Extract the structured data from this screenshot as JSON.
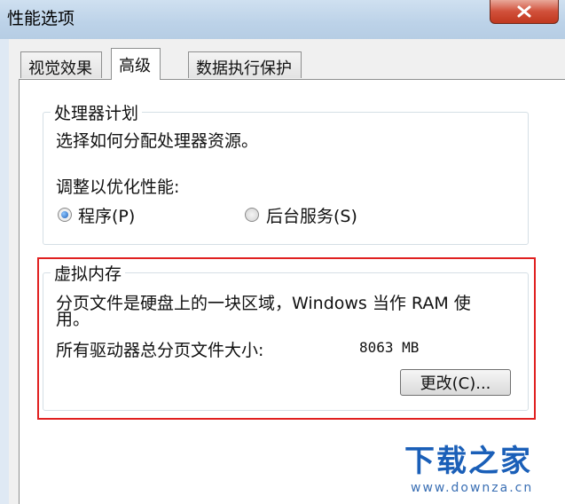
{
  "window": {
    "title": "性能选项",
    "close_label": "X"
  },
  "tabs": [
    {
      "label": "视觉效果",
      "active": false
    },
    {
      "label": "高级",
      "active": true
    },
    {
      "label": "数据执行保护",
      "active": false
    }
  ],
  "processor": {
    "legend": "处理器计划",
    "description": "选择如何分配处理器资源。",
    "adjust_label": "调整以优化性能:",
    "options": [
      {
        "label": "程序(P)",
        "checked": true
      },
      {
        "label": "后台服务(S)",
        "checked": false
      }
    ]
  },
  "virtual_memory": {
    "legend": "虚拟内存",
    "description_line1": "分页文件是硬盘上的一块区域，Windows 当作 RAM 使",
    "description_line2": "用。",
    "total_label": "所有驱动器总分页文件大小:",
    "total_value": "8063 MB",
    "change_button": "更改(C)..."
  },
  "watermark": {
    "logo": "下载之家",
    "url": "www.downza.cn"
  },
  "colors": {
    "highlight": "#e02020",
    "close_button": "#c8452e",
    "watermark": "#1a5fb8"
  }
}
